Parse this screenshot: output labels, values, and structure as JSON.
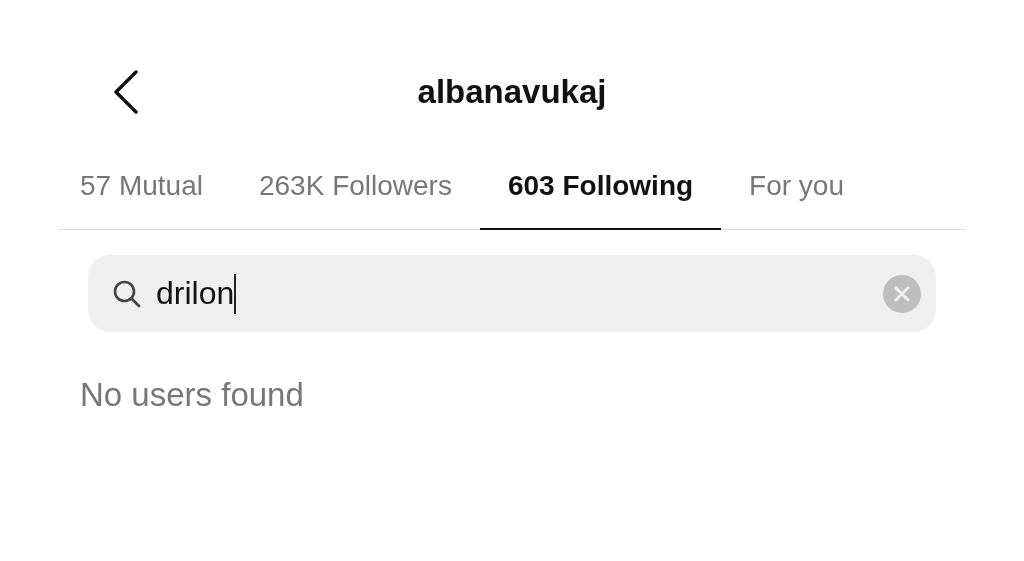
{
  "header": {
    "title": "albanavukaj"
  },
  "tabs": [
    {
      "label": "57 Mutual",
      "selected": false
    },
    {
      "label": "263K Followers",
      "selected": false
    },
    {
      "label": "603 Following",
      "selected": true
    },
    {
      "label": "For you",
      "selected": false
    }
  ],
  "search": {
    "value": "drilon"
  },
  "message": "No users found"
}
